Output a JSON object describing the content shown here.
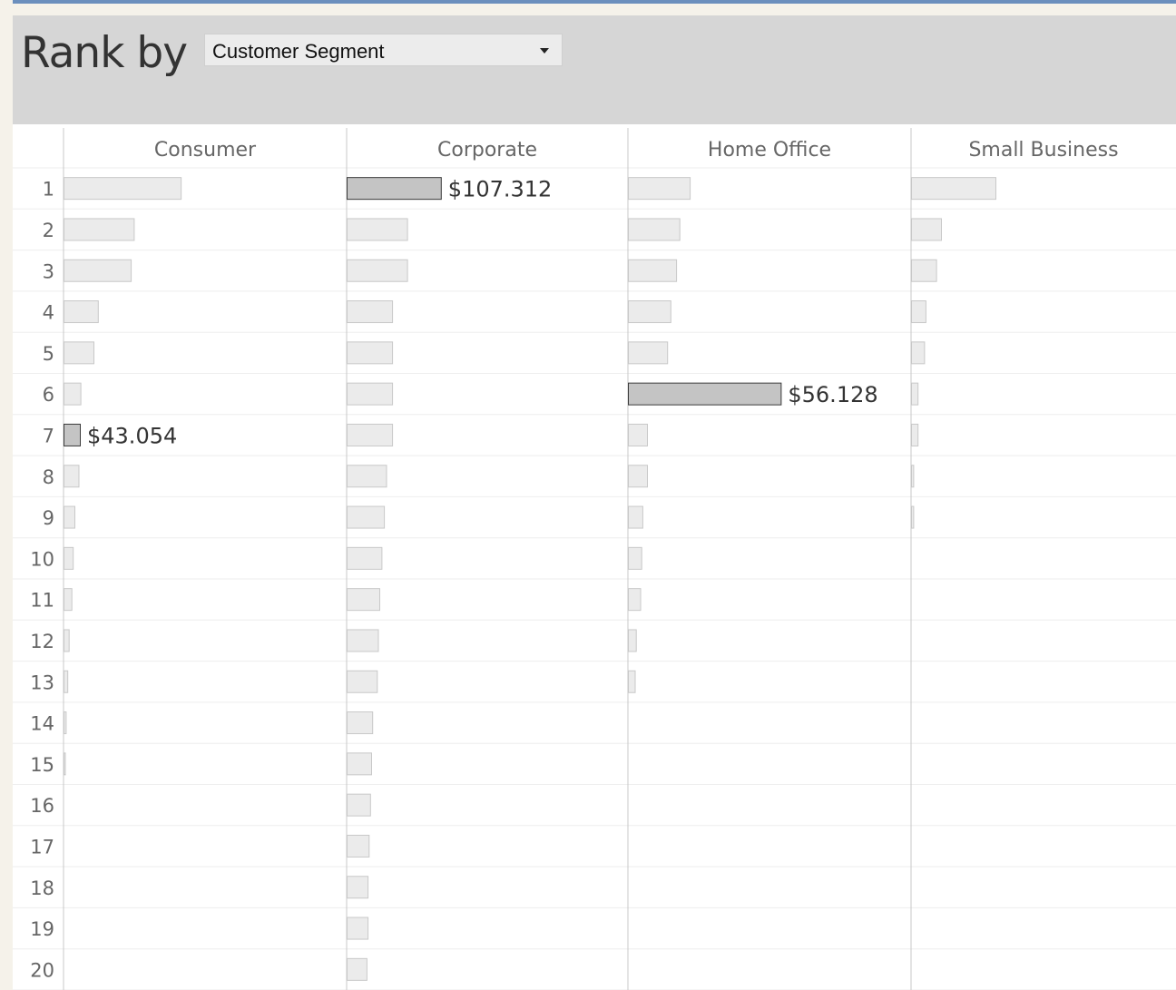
{
  "filter": {
    "title": "Rank by",
    "selected": "Customer Segment"
  },
  "chart_data": {
    "type": "bar",
    "ranks": [
      1,
      2,
      3,
      4,
      5,
      6,
      7,
      8,
      9,
      10,
      11,
      12,
      13,
      14,
      15,
      16,
      17,
      18,
      19,
      20
    ],
    "series": [
      {
        "name": "Consumer",
        "values": [
          43.054,
          25.8,
          24.7,
          12.6,
          11.0,
          6.2,
          6.0,
          5.5,
          4.0,
          3.4,
          2.9,
          1.9,
          1.4,
          0.8,
          0.5,
          null,
          null,
          null,
          null,
          null
        ],
        "highlight_rank": 7,
        "highlight_label": "$43.054"
      },
      {
        "name": "Corporate",
        "values": [
          34.6,
          22.2,
          22.2,
          16.7,
          16.7,
          16.7,
          16.7,
          14.5,
          13.7,
          12.8,
          12.0,
          11.5,
          11.1,
          9.4,
          9.0,
          8.6,
          8.1,
          7.7,
          7.7,
          7.3
        ],
        "highlight_rank": 1,
        "highlight_label": "$107.312"
      },
      {
        "name": "Home Office",
        "values": [
          22.7,
          18.9,
          17.7,
          15.6,
          14.4,
          56.128,
          7.0,
          7.0,
          5.3,
          4.9,
          4.5,
          2.9,
          2.5,
          null,
          null,
          null,
          null,
          null,
          null,
          null
        ],
        "highlight_rank": 6,
        "highlight_label": "$56.128"
      },
      {
        "name": "Small Business",
        "values": [
          31.0,
          11.0,
          9.2,
          5.3,
          4.8,
          2.4,
          2.4,
          0.8,
          0.8,
          null,
          null,
          null,
          null,
          null,
          null,
          null,
          null,
          null,
          null,
          null
        ],
        "highlight_rank": null,
        "highlight_label": ""
      }
    ]
  },
  "colors": {
    "bar_fill": "#ebebeb",
    "bar_stroke": "#c8c8c8",
    "highlight_fill": "#c4c4c4",
    "highlight_stroke": "#3a3a3a",
    "label_text": "#333333",
    "header_text": "#666666",
    "rank_text": "#666666",
    "gridline": "#eeeeee",
    "divider": "#c8c8c8"
  }
}
